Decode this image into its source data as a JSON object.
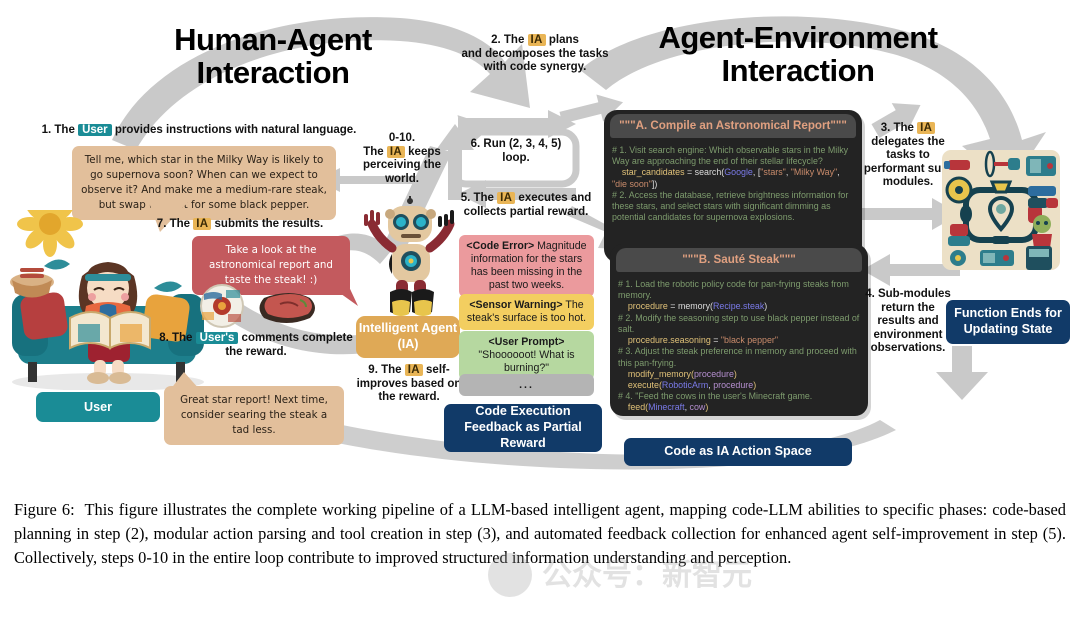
{
  "figure": {
    "titles": {
      "left": "Human-Agent\nInteraction",
      "left_l1": "Human-Agent",
      "left_l2": "Interaction",
      "right_l1": "Agent-Environment",
      "right_l2": "Interaction"
    },
    "badges": {
      "ia": "IA",
      "user": "User",
      "user_poss": "User's"
    },
    "colors": {
      "ia_badge": "#e9b556",
      "user_badge": "#1a8c96",
      "banner_blue": "#113a68",
      "arrow_grey": "#c9c9c9",
      "code_bg": "#232323",
      "code_header_bg": "#4a4a4a",
      "code_header_text": "#e0a080",
      "bubble_tan": "#e2bf9b",
      "bubble_red": "#c35a5e",
      "chip_error": "#eb9a9d",
      "chip_warning": "#f3ce60",
      "chip_prompt": "#b6d8a0",
      "chip_more": "#b4b4b4"
    },
    "steps": {
      "s1_a": "1. The ",
      "s1_b": " provides instructions with natural language.",
      "s2_l1": "2. The ",
      "s2_l1b": " plans",
      "s2_rest": "and decomposes the tasks with code synergy.",
      "s3_a": "3. The ",
      "s3_b": " delegates the tasks to performant sub-modules.",
      "s4": "4. Sub-modules return the results and environment observations.",
      "s5_a": "5. The ",
      "s5_b": " executes and collects partial reward.",
      "s6": "6. Run (2, 3, 4, 5) loop.",
      "s7_a": "7. The ",
      "s7_b": " submits the results.",
      "s8_a": "8. The ",
      "s8_b": " comments complete the reward.",
      "s9_a": "9. The ",
      "s9_b": " self-improves based on the reward.",
      "s0_head": "0-10.",
      "s0_a": "The ",
      "s0_b": " keeps perceiving the world."
    },
    "bubbles": {
      "user_request": "Tell me, which star in the Milky Way is likely to go supernova soon? When can we expect to observe it? And make me a medium-rare steak, but swap the salt for some black pepper.",
      "agent_reply": "Take a look at the astronomical report and taste the steak! :)",
      "user_feedback": "Great star report! Next time, consider searing the steak a tad less."
    },
    "feedback_chips": [
      {
        "tag": "<Code Error>",
        "text": " Magnitude information for the stars has been missing in the past two weeks.",
        "kind": "err"
      },
      {
        "tag": "<Sensor Warning>",
        "text": " The steak's surface is too hot.",
        "kind": "warn"
      },
      {
        "tag": "<User Prompt>",
        "text": "\"Shoooooot! What is burning?\"",
        "kind": "prompt"
      },
      {
        "tag": "",
        "text": "...",
        "kind": "more"
      }
    ],
    "banners": {
      "code_execution": "Code Execution Feedback as Partial Reward",
      "code_action_space": "Code as IA Action Space",
      "function_ends": "Function Ends for Updating State",
      "intelligent_agent": "Intelligent Agent (IA)",
      "user_label": "User"
    },
    "code_cards": [
      {
        "header": "\"\"\"A. Compile an Astronomical Report\"\"\"",
        "lines": [
          {
            "t": "c",
            "v": "# 1. Visit search engine: Which observable stars in the Milky Way are approaching the end of their stellar lifecycle?"
          },
          {
            "t": "code",
            "v": "    star_candidates = search(Google, [\"stars\", \"Milky Way\", \"die soon\"])"
          },
          {
            "t": "c",
            "v": "# 2. Access the database, retrieve brightness information for these stars, and select stars with significant dimming as potential candidates for supernova explosions."
          }
        ]
      },
      {
        "header": "\"\"\"B. Sauté Steak\"\"\"",
        "lines": [
          {
            "t": "c",
            "v": "# 1. Load the robotic policy code for pan-frying steaks from memory."
          },
          {
            "t": "code",
            "v": "    procedure = memory(Recipe.steak)"
          },
          {
            "t": "c",
            "v": "# 2. Modify the seasoning step to use black pepper instead of salt."
          },
          {
            "t": "code",
            "v": "    procedure.seasoning = \"black pepper\""
          },
          {
            "t": "c",
            "v": "# 3. Adjust the steak preference in memory and proceed with this pan-frying."
          },
          {
            "t": "code",
            "v": "    modify_memory(procedure)"
          },
          {
            "t": "code",
            "v": "    execute(RoboticArm, procedure)"
          },
          {
            "t": "c",
            "v": "# 4. \"Feed the cows in the user's Minecraft game."
          },
          {
            "t": "code",
            "v": "    feed(Minecraft, cow)"
          }
        ]
      }
    ]
  },
  "caption": {
    "label": "Figure 6:",
    "text": "This figure illustrates the complete working pipeline of a LLM-based intelligent agent, mapping code-LLM abilities to specific phases: code-based planning in step (2), modular action parsing and tool creation in step (3), and automated feedback collection for enhanced agent self-improvement in step (5). Collectively, steps 0-10 in the entire loop contribute to improved structured information understanding and perception."
  }
}
